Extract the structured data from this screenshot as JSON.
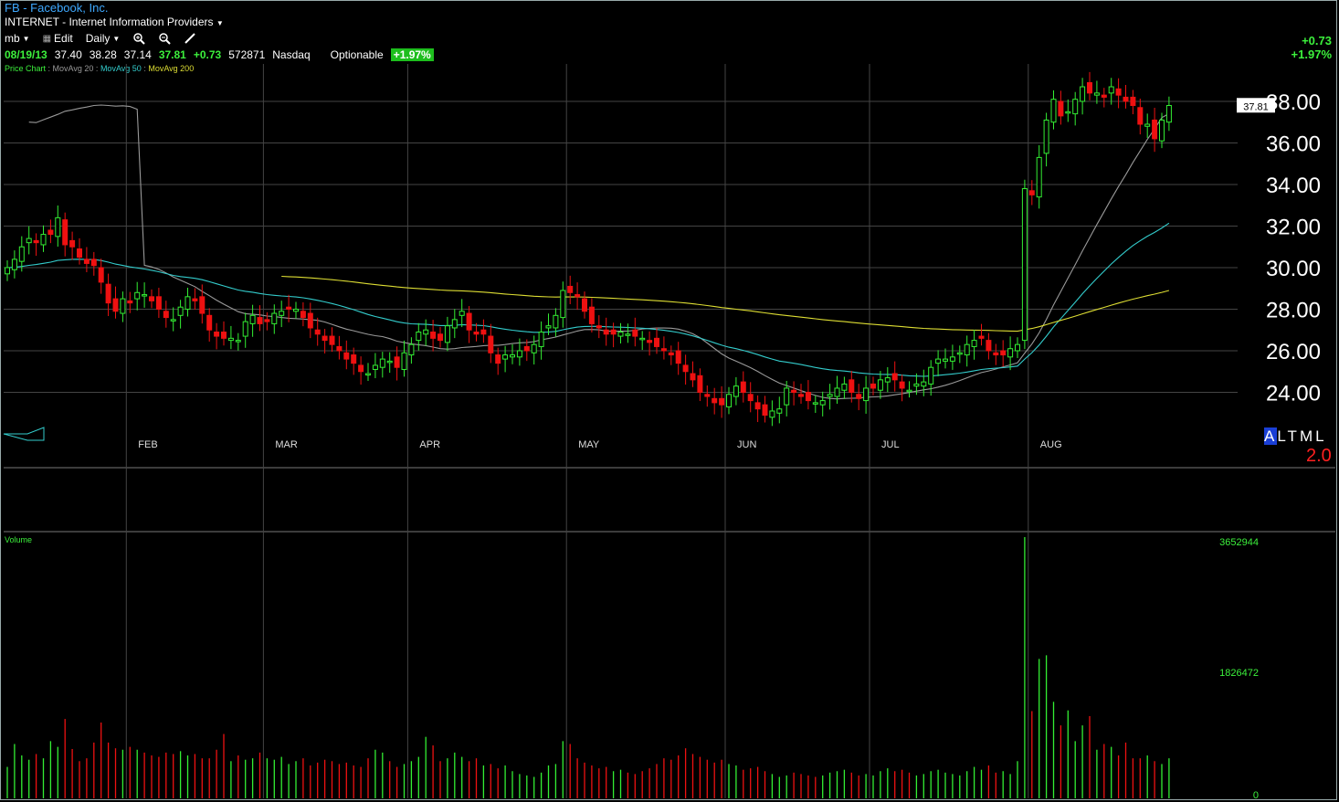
{
  "header": {
    "title": "FB - Facebook, Inc.",
    "industry": "INTERNET - Internet Information Providers",
    "toolbar": {
      "user": "mb",
      "edit": "Edit",
      "interval": "Daily"
    },
    "quote": {
      "date": "08/19/13",
      "open": "37.40",
      "high": "38.28",
      "low": "37.14",
      "last": "37.81",
      "change": "+0.73",
      "volume": "572871",
      "exchange": "Nasdaq",
      "optionable": "Optionable",
      "pct_change": "+1.97%"
    },
    "legend": {
      "price": "Price Chart",
      "ma20": "MovAvg 20",
      "ma50": "MovAvg 50",
      "ma200": "MovAvg 200"
    },
    "right_change": "+0.73",
    "right_pct": "+1.97%"
  },
  "colors": {
    "up": "#33ee33",
    "down": "#ee1111",
    "ma20": "#999999",
    "ma50": "#33cccc",
    "ma200": "#dddd33",
    "grid": "#444444",
    "price_label": "#ffffff"
  },
  "tools": {
    "zoom_in": "zoom-in-icon",
    "zoom_out": "zoom-out-icon",
    "draw": "pencil-icon"
  },
  "mode_buttons": [
    "A",
    "L",
    "T",
    "M",
    "L"
  ],
  "selected_mode": "A",
  "version": "2.0",
  "chart_data": {
    "type": "candlestick",
    "price_ticks": [
      "24.00",
      "26.00",
      "28.00",
      "30.00",
      "32.00",
      "34.00",
      "36.00",
      "38.00"
    ],
    "price_range": [
      22.0,
      39.8
    ],
    "last_price_label": "37.81",
    "months": [
      {
        "label": "FEB",
        "index": 17
      },
      {
        "label": "MAR",
        "index": 36
      },
      {
        "label": "APR",
        "index": 56
      },
      {
        "label": "MAY",
        "index": 78
      },
      {
        "label": "JUN",
        "index": 100
      },
      {
        "label": "JUL",
        "index": 120
      },
      {
        "label": "AUG",
        "index": 142
      }
    ],
    "volume_label": "Volume",
    "volume_ticks": [
      "3652944",
      "1826472",
      "0"
    ],
    "volume_max": 3652944,
    "closes": [
      30.0,
      30.4,
      31.0,
      31.4,
      31.2,
      31.6,
      31.6,
      32.4,
      31.1,
      31.0,
      30.5,
      30.2,
      30.1,
      29.3,
      28.3,
      27.9,
      28.5,
      28.3,
      28.8,
      28.7,
      28.4,
      28.0,
      27.6,
      27.5,
      28.1,
      28.6,
      28.4,
      27.8,
      27.0,
      26.7,
      26.6,
      26.6,
      26.5,
      27.4,
      27.7,
      27.3,
      27.4,
      27.8,
      27.9,
      28.0,
      28.0,
      27.6,
      27.1,
      26.8,
      26.5,
      26.3,
      26.0,
      25.6,
      25.4,
      25.0,
      24.9,
      25.3,
      25.6,
      25.5,
      25.2,
      25.9,
      26.3,
      26.9,
      27.0,
      26.6,
      26.5,
      27.2,
      27.5,
      27.9,
      27.0,
      26.8,
      26.8,
      25.9,
      25.4,
      25.8,
      25.8,
      26.0,
      26.0,
      26.3,
      26.9,
      27.2,
      27.7,
      28.9,
      28.8,
      28.6,
      27.9,
      27.3,
      27.1,
      26.8,
      26.8,
      26.9,
      26.8,
      26.7,
      26.6,
      26.4,
      26.2,
      26.0,
      25.8,
      25.4,
      25.0,
      24.6,
      24.0,
      23.8,
      23.5,
      23.4,
      23.9,
      24.3,
      24.0,
      23.6,
      23.2,
      22.9,
      23.1,
      23.2,
      24.2,
      24.0,
      23.8,
      23.6,
      23.5,
      23.6,
      23.9,
      24.2,
      24.4,
      24.0,
      23.7,
      24.2,
      24.2,
      24.6,
      24.7,
      24.6,
      24.2,
      24.1,
      24.4,
      24.5,
      25.2,
      25.6,
      25.6,
      25.7,
      25.9,
      26.3,
      26.5,
      26.6,
      26.0,
      25.8,
      25.8,
      26.1,
      26.3,
      33.8,
      33.5,
      35.3,
      37.1,
      38.1,
      37.3,
      37.5,
      38.1,
      38.7,
      38.4,
      38.4,
      38.2,
      38.7,
      38.3,
      38.0,
      37.8,
      36.9,
      36.9,
      36.2,
      37.1,
      37.8
    ],
    "volumes": [
      440000,
      760000,
      600000,
      540000,
      620000,
      560000,
      800000,
      720000,
      1110000,
      690000,
      520000,
      560000,
      780000,
      1060000,
      780000,
      700000,
      680000,
      720000,
      680000,
      640000,
      600000,
      580000,
      640000,
      620000,
      660000,
      600000,
      620000,
      560000,
      560000,
      680000,
      900000,
      520000,
      600000,
      540000,
      560000,
      640000,
      560000,
      540000,
      580000,
      480000,
      520000,
      560000,
      460000,
      500000,
      540000,
      520000,
      480000,
      500000,
      460000,
      440000,
      560000,
      680000,
      640000,
      520000,
      440000,
      480000,
      520000,
      580000,
      860000,
      740000,
      520000,
      560000,
      640000,
      580000,
      520000,
      560000,
      460000,
      480000,
      420000,
      460000,
      380000,
      340000,
      320000,
      300000,
      360000,
      460000,
      480000,
      800000,
      760000,
      560000,
      500000,
      460000,
      420000,
      440000,
      380000,
      400000,
      360000,
      340000,
      380000,
      420000,
      480000,
      560000,
      540000,
      600000,
      700000,
      620000,
      580000,
      540000,
      500000,
      540000,
      480000,
      460000,
      400000,
      420000,
      440000,
      380000,
      340000,
      300000,
      320000,
      360000,
      340000,
      320000,
      300000,
      320000,
      360000,
      380000,
      400000,
      360000,
      320000,
      340000,
      320000,
      380000,
      420000,
      380000,
      400000,
      360000,
      320000,
      340000,
      380000,
      400000,
      360000,
      340000,
      320000,
      380000,
      440000,
      400000,
      460000,
      360000,
      380000,
      340000,
      520000,
      3652944,
      1220000,
      1950000,
      2000000,
      1350000,
      1020000,
      1230000,
      800000,
      1020000,
      1150000,
      680000,
      760000,
      720000,
      600000,
      780000,
      560000,
      560000,
      600000,
      520000,
      480000,
      560000
    ]
  }
}
